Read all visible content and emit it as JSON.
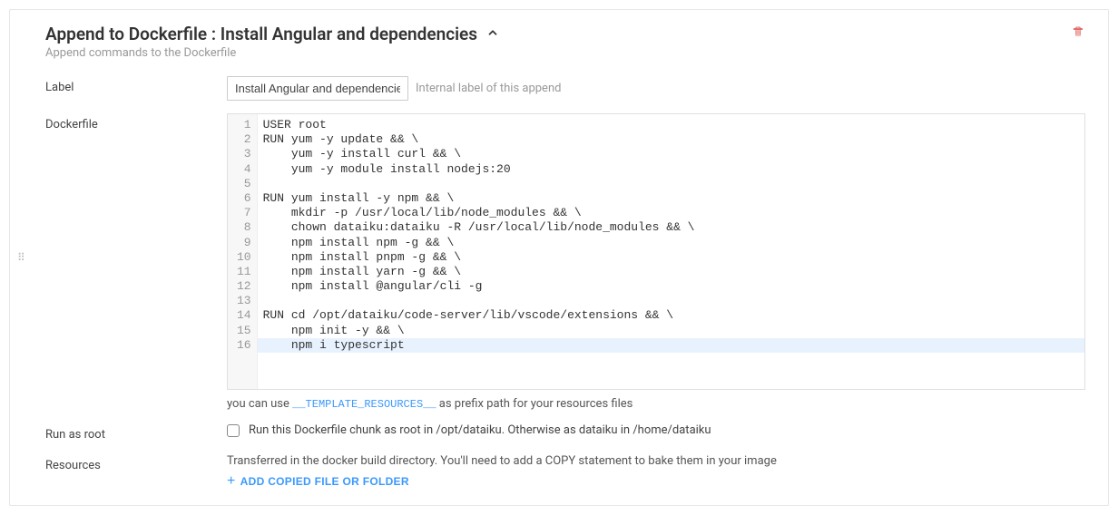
{
  "header": {
    "title": "Append to Dockerfile : Install Angular and dependencies",
    "subtitle": "Append commands to the Dockerfile"
  },
  "form": {
    "label": {
      "caption": "Label",
      "value": "Install Angular and dependencies",
      "hint": "Internal label of this append"
    },
    "dockerfile": {
      "caption": "Dockerfile",
      "lines": [
        "USER root",
        "RUN yum -y update && \\",
        "    yum -y install curl && \\",
        "    yum -y module install nodejs:20",
        "",
        "RUN yum install -y npm && \\",
        "    mkdir -p /usr/local/lib/node_modules && \\",
        "    chown dataiku:dataiku -R /usr/local/lib/node_modules && \\",
        "    npm install npm -g && \\",
        "    npm install pnpm -g && \\",
        "    npm install yarn -g && \\",
        "    npm install @angular/cli -g",
        "",
        "RUN cd /opt/dataiku/code-server/lib/vscode/extensions && \\",
        "    npm init -y && \\",
        "    npm i typescript"
      ],
      "help_prefix": "you can use ",
      "help_template": "__TEMPLATE_RESOURCES__",
      "help_suffix": " as prefix path for your resources files"
    },
    "runAsRoot": {
      "caption": "Run as root",
      "checked": false,
      "label": "Run this Dockerfile chunk as root in /opt/dataiku. Otherwise as dataiku in /home/dataiku"
    },
    "resources": {
      "caption": "Resources",
      "description": "Transferred in the docker build directory. You'll need to add a COPY statement to bake them in your image",
      "addButton": "ADD COPIED FILE OR FOLDER"
    }
  }
}
